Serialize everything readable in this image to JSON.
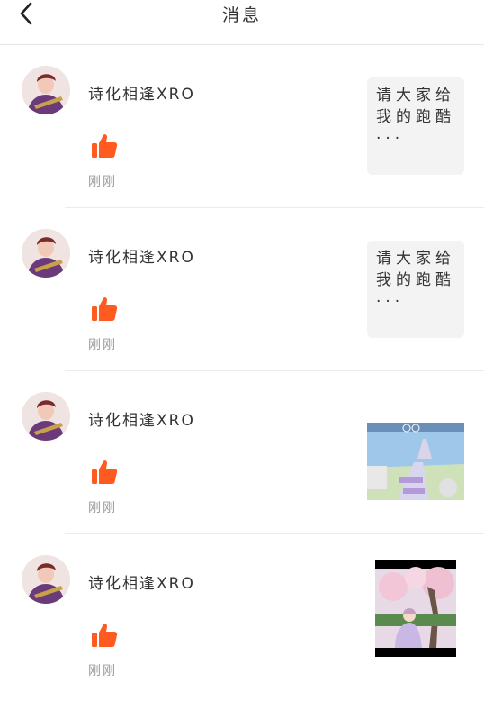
{
  "header": {
    "title": "消息",
    "back_icon": "chevron-left-icon"
  },
  "messages": [
    {
      "user": "诗化相逢XRO",
      "action_icon": "thumbs-up-icon",
      "time": "刚刚",
      "preview_type": "text",
      "preview_text": "请大家给我的跑酷···"
    },
    {
      "user": "诗化相逢XRO",
      "action_icon": "thumbs-up-icon",
      "time": "刚刚",
      "preview_type": "text",
      "preview_text": "请大家给我的跑酷···"
    },
    {
      "user": "诗化相逢XRO",
      "action_icon": "thumbs-up-icon",
      "time": "刚刚",
      "preview_type": "image"
    },
    {
      "user": "诗化相逢XRO",
      "action_icon": "thumbs-up-icon",
      "time": "刚刚",
      "preview_type": "image"
    }
  ],
  "colors": {
    "accent": "#ff5a1f",
    "time_text": "#999999",
    "divider": "#ebebeb",
    "preview_bg": "#f3f3f3"
  }
}
